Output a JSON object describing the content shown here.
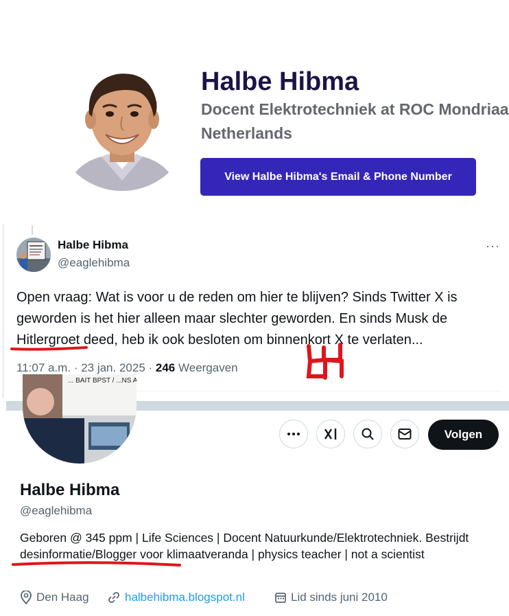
{
  "profile_card": {
    "name": "Halbe Hibma",
    "job_title": "Docent Elektrotechniek at ROC Mondriaa",
    "country": "Netherlands",
    "cta_label": "View Halbe Hibma's Email & Phone Number"
  },
  "tweet": {
    "author_name": "Halbe Hibma",
    "author_handle": "@eaglehibma",
    "more": "···",
    "text": "Open vraag: Wat is voor u de reden om hier te blijven? Sinds Twitter X is geworden is het hier alleen maar slechter geworden. En sinds Musk de Hitlergroet deed, heb ik ook besloten om binnenkort X te verlaten...",
    "time": "11:07 a.m.",
    "date": "23 jan. 2025",
    "views_count": "246",
    "views_label": "Weergaven"
  },
  "x_profile": {
    "name": "Halbe Hibma",
    "handle": "@eaglehibma",
    "follow_label": "Volgen",
    "bio": "Geboren @ 345 ppm | Life Sciences | Docent Natuurkunde/Elektrotechniek. Bestrijdt desinformatie/Blogger voor klimaatveranda | physics teacher | not a scientist",
    "location": "Den Haag",
    "website": "halbehibma.blogspot.nl",
    "joined": "Lid sinds juni 2010",
    "avatar_sign_text": "... BAIT BPST / ...NS AGAINST WA..."
  },
  "annotations": {
    "color": "#e0151b"
  },
  "colors": {
    "card_name": "#1c1446",
    "cta_background": "#3326b8",
    "link": "#1d9bf0",
    "follow_button": "#0f1419"
  }
}
